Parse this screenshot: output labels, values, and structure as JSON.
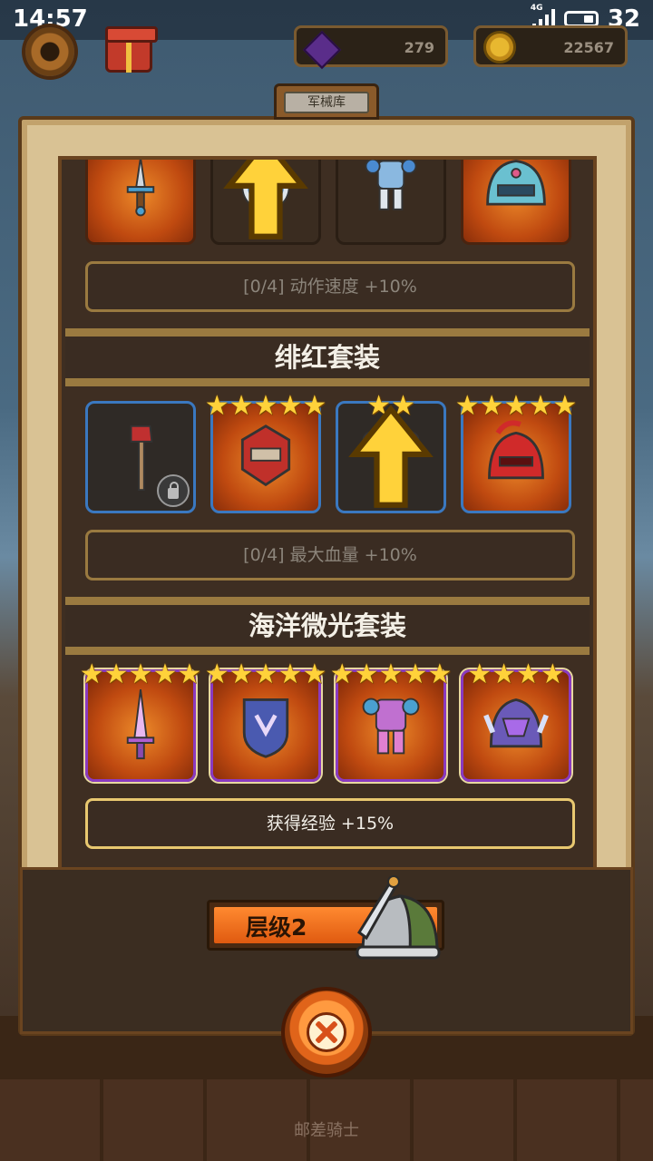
{
  "status_bar": {
    "time": "14:57",
    "network": "4G",
    "battery": "32"
  },
  "hud": {
    "gems": "279",
    "coins": "22567"
  },
  "panel": {
    "title": "军械库"
  },
  "sets": [
    {
      "name": "",
      "bonus": "[0/4] 动作速度 +10%",
      "bonus_active": false,
      "items": [
        {
          "icon": "dagger-icon",
          "stars": 0,
          "slot": "fire",
          "upgrade": false,
          "locked": false
        },
        {
          "icon": "round-shield-icon",
          "stars": 0,
          "slot": "dark",
          "upgrade": true,
          "locked": false
        },
        {
          "icon": "armor-icon",
          "stars": 0,
          "slot": "dark",
          "upgrade": false,
          "locked": false
        },
        {
          "icon": "helmet-icon",
          "stars": 0,
          "slot": "fire",
          "upgrade": false,
          "locked": false
        }
      ]
    },
    {
      "name": "绯红套装",
      "bonus": "[0/4] 最大血量 +10%",
      "bonus_active": false,
      "items": [
        {
          "icon": "axe-icon",
          "stars": 0,
          "slot": "darkblue",
          "upgrade": false,
          "locked": true
        },
        {
          "icon": "spiked-shield-icon",
          "stars": 5,
          "slot": "fireblue",
          "upgrade": false,
          "locked": false
        },
        {
          "icon": "crimson-armor-icon",
          "stars": 2,
          "slot": "darkblue",
          "upgrade": true,
          "locked": false
        },
        {
          "icon": "crimson-helmet-icon",
          "stars": 5,
          "slot": "fireblue",
          "upgrade": false,
          "locked": false
        }
      ]
    },
    {
      "name": "海洋微光套装",
      "bonus": "获得经验 +15%",
      "bonus_active": true,
      "items": [
        {
          "icon": "crystal-sword-icon",
          "stars": 5,
          "slot": "firepurple",
          "upgrade": false,
          "locked": false
        },
        {
          "icon": "ocean-shield-icon",
          "stars": 5,
          "slot": "firepurple",
          "upgrade": false,
          "locked": false
        },
        {
          "icon": "ocean-armor-icon",
          "stars": 5,
          "slot": "firepurple",
          "upgrade": false,
          "locked": false
        },
        {
          "icon": "ocean-helmet-icon",
          "stars": 4,
          "slot": "firepurple",
          "upgrade": false,
          "locked": false
        }
      ]
    }
  ],
  "tier": {
    "label": "层级2"
  },
  "footer": {
    "game_name": "邮差骑士"
  },
  "colors": {
    "star": "#ffd23a",
    "bonus_active_border": "#e8c870",
    "tier_fill": "#ff8a30"
  }
}
